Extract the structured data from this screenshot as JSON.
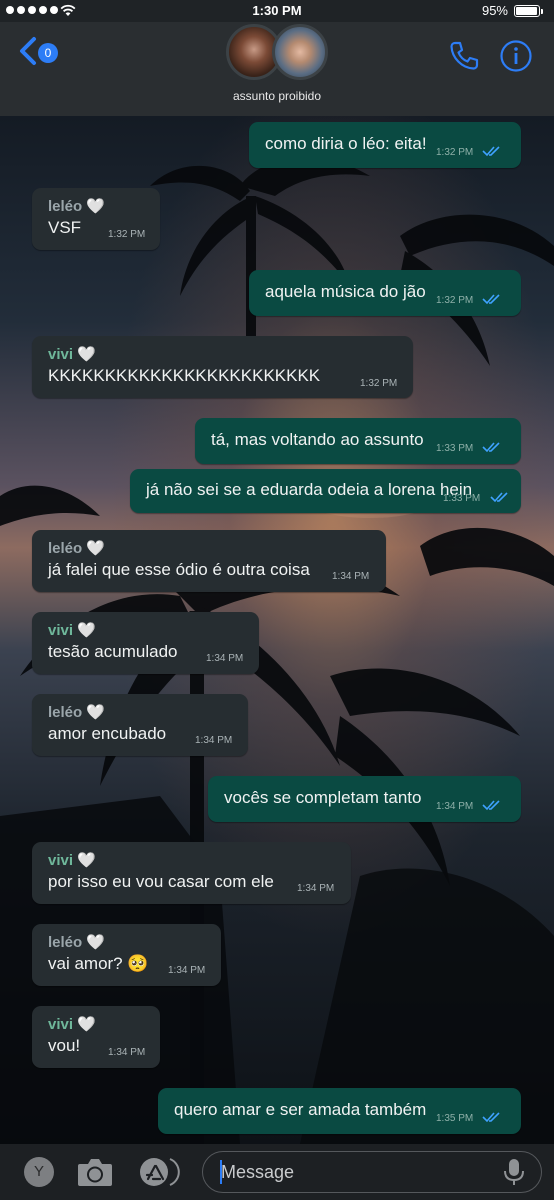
{
  "status_bar": {
    "time": "1:30 PM",
    "battery": "95%"
  },
  "header": {
    "back_badge": "0",
    "group_name": "assunto proibido",
    "colors": {
      "accent": "#2d7df6"
    }
  },
  "messages": [
    {
      "direction": "out",
      "text": "como diria o léo: eita!",
      "time": "1:32 PM"
    },
    {
      "direction": "in",
      "sender": "leléo",
      "heart": "🤍",
      "text": "VSF",
      "time": "1:32 PM"
    },
    {
      "direction": "out",
      "text": "aquela música do jão",
      "time": "1:32 PM"
    },
    {
      "direction": "in",
      "sender": "vivi",
      "heart": "🤍",
      "text": "KKKKKKKKKKKKKKKKKKKKKKKK",
      "time": "1:32 PM"
    },
    {
      "direction": "out",
      "text": "tá, mas voltando ao assunto",
      "time": "1:33 PM"
    },
    {
      "direction": "out",
      "text": "já não sei se a eduarda odeia a lorena hein",
      "time": "1:33 PM"
    },
    {
      "direction": "in",
      "sender": "leléo",
      "heart": "🤍",
      "text": "já falei que esse ódio é outra coisa",
      "time": "1:34 PM"
    },
    {
      "direction": "in",
      "sender": "vivi",
      "heart": "🤍",
      "text": "tesão acumulado",
      "time": "1:34 PM"
    },
    {
      "direction": "in",
      "sender": "leléo",
      "heart": "🤍",
      "text": "amor encubado",
      "time": "1:34 PM"
    },
    {
      "direction": "out",
      "text": "vocês se completam tanto",
      "time": "1:34 PM"
    },
    {
      "direction": "in",
      "sender": "vivi",
      "heart": "🤍",
      "text": "por isso eu vou casar com ele",
      "time": "1:34 PM"
    },
    {
      "direction": "in",
      "sender": "leléo",
      "heart": "🤍",
      "text": "vai amor? 🥺",
      "time": "1:34 PM"
    },
    {
      "direction": "in",
      "sender": "vivi",
      "heart": "🤍",
      "text": "vou!",
      "time": "1:34 PM"
    },
    {
      "direction": "out",
      "text": "quero amar e ser amada também",
      "time": "1:35 PM"
    }
  ],
  "input_bar": {
    "keyboard_button": "Y",
    "placeholder": "Message",
    "icons": [
      "camera-icon",
      "app-store-icon",
      "microphone-icon"
    ]
  }
}
